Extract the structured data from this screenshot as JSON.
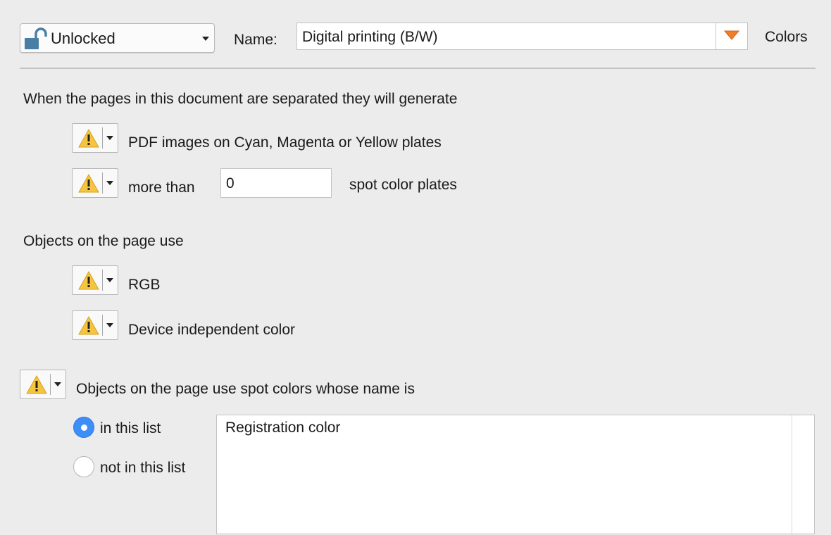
{
  "lock_select": {
    "value": "Unlocked"
  },
  "name_label": "Name:",
  "name_field": {
    "value": "Digital printing (B/W)"
  },
  "category_label": "Colors",
  "section_separation": {
    "heading": "When the pages in this document are separated they will generate",
    "rows": [
      {
        "label": "PDF images on Cyan, Magenta or Yellow plates"
      },
      {
        "label_before": "more than",
        "value": "0",
        "label_after": "spot color plates"
      }
    ]
  },
  "section_objects": {
    "heading": "Objects on the page use",
    "rows": [
      {
        "label": "RGB"
      },
      {
        "label": "Device independent color"
      }
    ]
  },
  "spot_section": {
    "label": "Objects on the page use spot colors whose name is",
    "radios": [
      {
        "label": "in this list",
        "selected": true
      },
      {
        "label": "not in this list",
        "selected": false
      }
    ],
    "list_items": [
      "Registration color"
    ]
  },
  "colors": {
    "warning_fill": "#f5c542",
    "accent_orange": "#f07d2a",
    "radio_blue": "#3d8ff7",
    "lock_blue": "#4a7fa5"
  },
  "icons": {
    "lock": "unlocked-padlock-icon",
    "severity": "warning-triangle-icon",
    "menu": "orange-triangle-down-icon"
  }
}
